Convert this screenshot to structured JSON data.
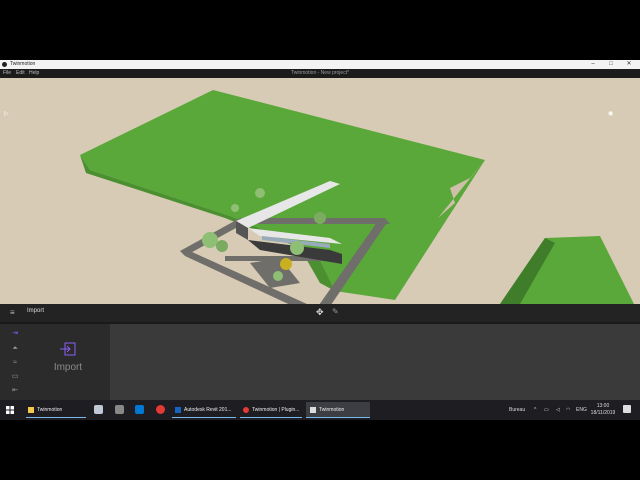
{
  "window": {
    "app_title": "Twinmotion",
    "project_title": "Twinmotion - New project*"
  },
  "menu": {
    "items": [
      "File",
      "Edit",
      "Help"
    ]
  },
  "panel": {
    "title": "Import",
    "import_label": "Import"
  },
  "taskbar": {
    "apps": [
      "Twinmotion",
      "Autodesk Revit 201...",
      "Twinmotion | Plugin...",
      "Twinmotion"
    ],
    "tray_label": "Bureau",
    "language": "ENG",
    "time": "13:00",
    "date": "18/11/2019"
  },
  "colors": {
    "ground": "#d8cbb5",
    "grass": "#5aa83a",
    "road": "#6f6e6a",
    "accent": "#8b5cf6"
  }
}
